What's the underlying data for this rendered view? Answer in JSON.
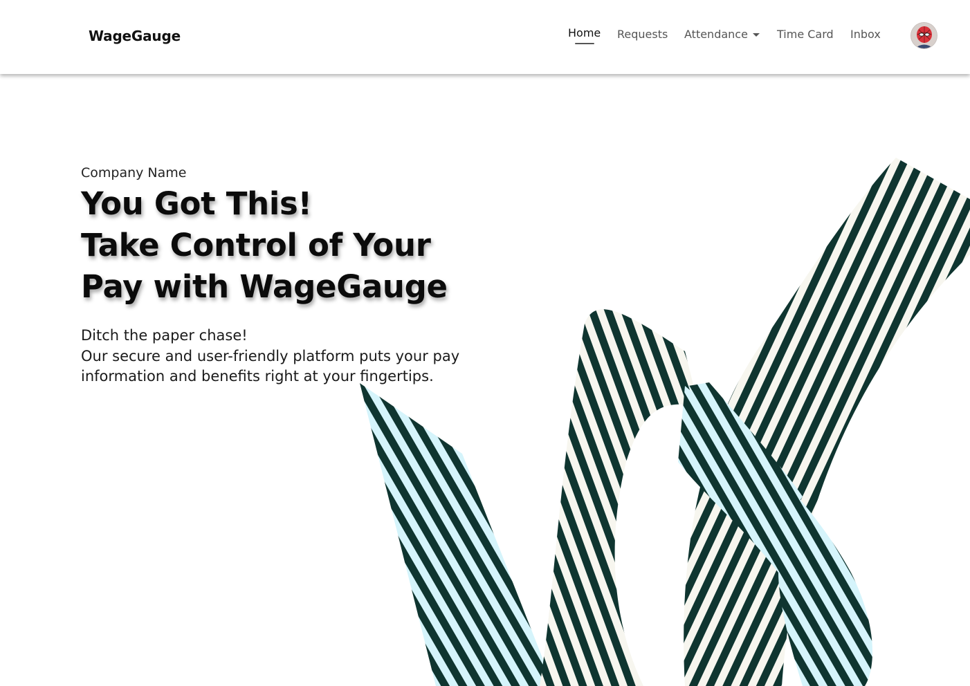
{
  "header": {
    "brand": "WageGauge",
    "nav": [
      {
        "label": "Home",
        "active": true
      },
      {
        "label": "Requests"
      },
      {
        "label": "Attendance",
        "has_dropdown": true
      },
      {
        "label": "Time Card"
      },
      {
        "label": "Inbox"
      }
    ],
    "avatar_icon": "user-avatar-icon"
  },
  "hero": {
    "company": "Company Name",
    "headline_lines": [
      "You Got This!",
      "Take Control of Your",
      "Pay with WageGauge"
    ],
    "subcopy_lines": [
      "Ditch the paper chase!",
      "Our secure and user-friendly platform puts your pay",
      "information and benefits right at your fingertips."
    ],
    "ribbon_colors": {
      "stripe_dark": "#0f3530",
      "stripe_light": "#f7f6ef",
      "stripe_back": "#d5f4fb"
    }
  }
}
